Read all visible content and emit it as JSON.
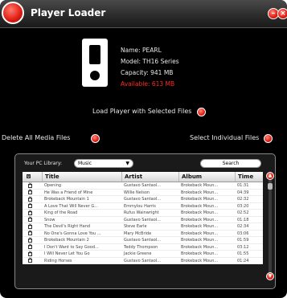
{
  "window": {
    "title": "Player Loader"
  },
  "device": {
    "name": "Name: PEARL",
    "model": "Model: TH16 Series",
    "capacity": "Capacity: 941 MB",
    "available": "Available: 613 MB"
  },
  "actions": {
    "load": "Load Player with Selected Files",
    "delete_all": "Delete All Media Files",
    "select_individual": "Select Individual Files"
  },
  "library": {
    "label": "Your PC Library:",
    "selected": "Music",
    "search_placeholder": "Search",
    "columns": {
      "title": "Title",
      "artist": "Artist",
      "album": "Album",
      "time": "Time"
    },
    "rows": [
      {
        "title": "Opening",
        "artist": "Gustavo Santaol...",
        "album": "Brokeback Moun...",
        "time": "01:31"
      },
      {
        "title": "He Was a Friend of Mine",
        "artist": "Willie Nelson",
        "album": "Brokeback Moun...",
        "time": "04:39"
      },
      {
        "title": "Brokeback Mountain 1",
        "artist": "Gustavo Santaol...",
        "album": "Brokeback Moun...",
        "time": "02:32"
      },
      {
        "title": "A Love That Will Never G...",
        "artist": "Emmylou Harris",
        "album": "Brokeback Moun...",
        "time": "03:20"
      },
      {
        "title": "King of the Road",
        "artist": "Rufus Wainwright",
        "album": "Brokeback Moun...",
        "time": "02:52"
      },
      {
        "title": "Snow",
        "artist": "Gustavo Santaol...",
        "album": "Brokeback Moun...",
        "time": "01:18"
      },
      {
        "title": "The Devil's Right Hand",
        "artist": "Steve Earle",
        "album": "Brokeback Moun...",
        "time": "02:34"
      },
      {
        "title": "No One's Gonna Love You ...",
        "artist": "Mary McBride",
        "album": "Brokeback Moun...",
        "time": "03:06"
      },
      {
        "title": "Brokeback Mountain 2",
        "artist": "Gustavo Santaol...",
        "album": "Brokeback Moun...",
        "time": "01:59"
      },
      {
        "title": "I Don't Want to Say Good...",
        "artist": "Teddy Thompson",
        "album": "Brokeback Moun...",
        "time": "03:12"
      },
      {
        "title": "I Will Never Let You Go",
        "artist": "Jackie Greene",
        "album": "Brokeback Moun...",
        "time": "01:55"
      },
      {
        "title": "Riding Horses",
        "artist": "Gustavo Santaol...",
        "album": "Brokeback Moun...",
        "time": "01:24"
      }
    ]
  }
}
